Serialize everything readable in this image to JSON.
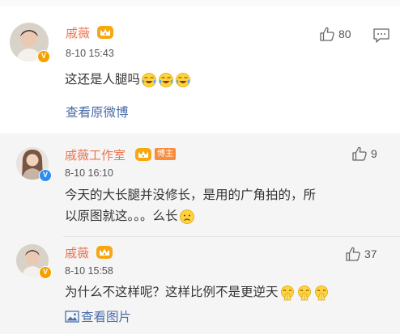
{
  "main_comment": {
    "username": "戚薇",
    "time": "8-10 15:43",
    "likes": "80",
    "content": "这还是人腿吗",
    "emojis": [
      "laugh-cry-emoji",
      "laugh-cry-emoji",
      "laugh-cry-emoji"
    ],
    "view_original": "查看原微博"
  },
  "replies": [
    {
      "username": "戚薇工作室",
      "badge": "博主",
      "time": "8-10 16:10",
      "likes": "9",
      "content_line1": "今天的大长腿并没修长，是用的广角拍的，所",
      "content_line2": "以原图就这。。。么长",
      "emojis": [
        "sad-face-emoji"
      ]
    },
    {
      "username": "戚薇",
      "time": "8-10 15:58",
      "likes": "37",
      "content": "为什么不这样呢？这样比例不是更逆天",
      "emojis": [
        "pray-emoji",
        "pray-emoji",
        "pray-emoji"
      ],
      "view_image": "查看图片"
    }
  ],
  "colors": {
    "username": "#eb7350",
    "link": "#4a6ea9",
    "reply_background": "#f5f5f5",
    "verified_orange": "#f2a100",
    "verified_blue": "#2d8cf0",
    "badge": "#f98d3c"
  }
}
